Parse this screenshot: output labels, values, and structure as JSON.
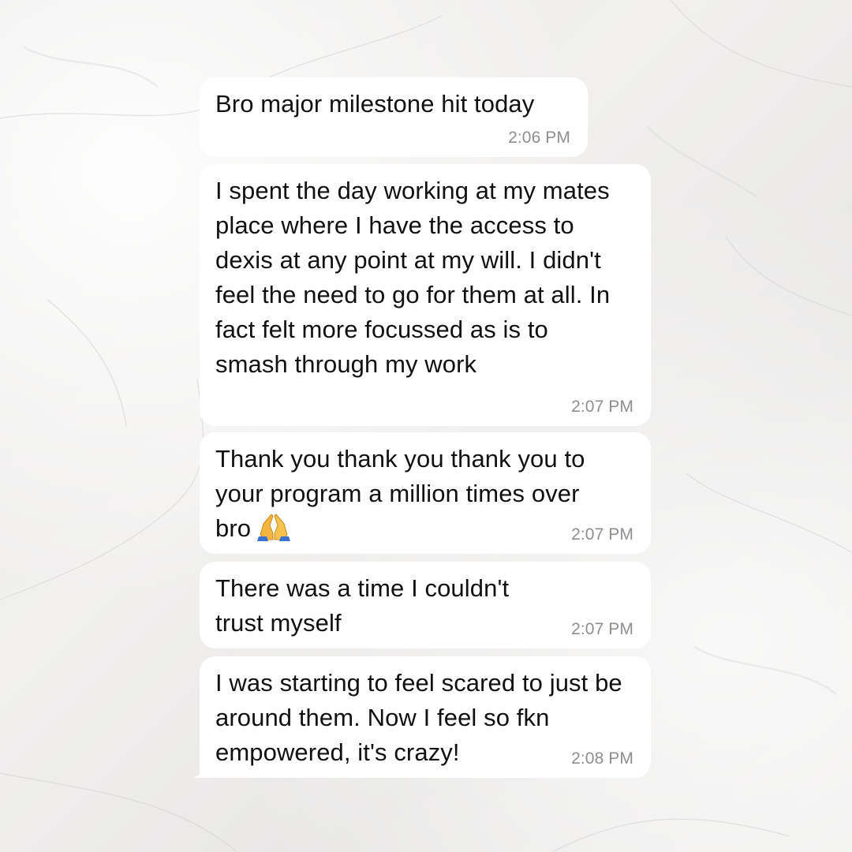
{
  "messages": [
    {
      "text": "Bro major milestone hit today",
      "time": "2:06 PM"
    },
    {
      "text": "I spent the day working at my mates place where I have the access to dexis at any point at my will. I didn't feel the need to go for them at all. In fact felt more focussed as is to smash through my work",
      "time": "2:07 PM"
    },
    {
      "text": "Thank you thank you thank you to your program a million times over bro",
      "emoji": "folded-hands-icon",
      "time": "2:07 PM"
    },
    {
      "text": "There was a time I couldn't trust myself",
      "time": "2:07 PM"
    },
    {
      "text": "I was starting to feel scared to just be around them. Now I feel so fkn empowered, it's crazy!",
      "time": "2:08 PM"
    }
  ],
  "colors": {
    "bubble": "#ffffff",
    "text": "#111111",
    "timestamp": "#8e8e93",
    "background": "#eeedec"
  }
}
